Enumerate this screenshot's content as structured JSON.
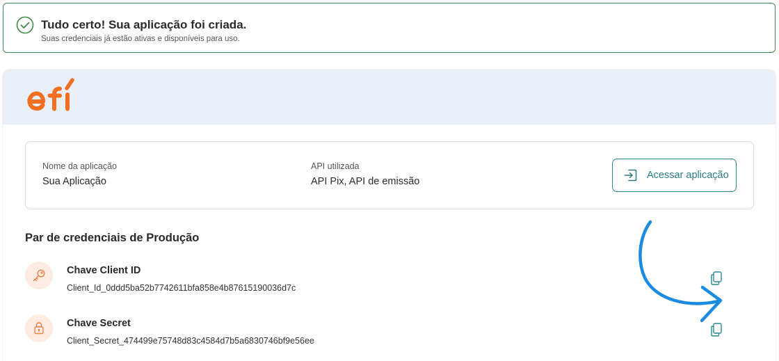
{
  "banner": {
    "title": "Tudo certo! Sua aplicação foi criada.",
    "subtitle": "Suas credenciais já estão ativas e disponíveis para uso.",
    "icon": "check-circle-icon",
    "color": "#3f8a46"
  },
  "brand": {
    "logo_text": "efí",
    "color": "#f26f21"
  },
  "application": {
    "name_label": "Nome da aplicação",
    "name_value": "Sua Aplicação",
    "api_label": "API utilizada",
    "api_value": "API Pix, API de emissão",
    "access_button": "Acessar aplicação",
    "accent": "#2a8a8f"
  },
  "credentials": {
    "section_title": "Par de credenciais de Produção",
    "items": [
      {
        "name": "Chave Client ID",
        "value": "Client_Id_0ddd5ba52b7742611bfa858e4b87615190036d7c",
        "icon": "key-icon"
      },
      {
        "name": "Chave Secret",
        "value": "Client_Secret_474499e75748d83c4584d7b5a6830746bf9e56ee",
        "icon": "lock-icon"
      }
    ]
  },
  "annotation": {
    "color": "#1a8be0",
    "icon": "curved-arrow-icon"
  }
}
